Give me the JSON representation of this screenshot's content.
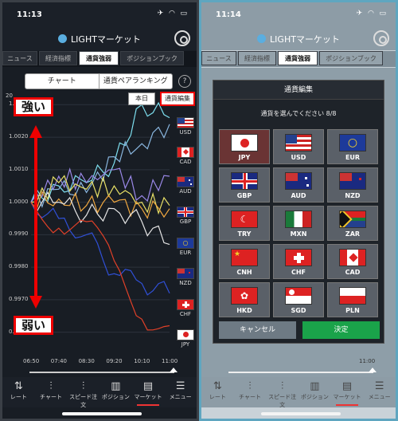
{
  "left": {
    "status_time": "11:13",
    "app_title": "LIGHTマーケット",
    "tabs": [
      "ニュース",
      "経済指標",
      "通貨強弱",
      "ポジションブック"
    ],
    "segment": [
      "チャート",
      "通貨ペアランキング"
    ],
    "help": "?",
    "today_button": "本日",
    "edit_button": "通貨編集",
    "annotation_strong": "強い",
    "annotation_weak": "弱い",
    "y_ticks": [
      "1.0030",
      "1.0020",
      "1.0010",
      "1.0000",
      "0.9990",
      "0.9980",
      "0.9970",
      "0.9960"
    ],
    "y_top_partial": "20",
    "x_ticks": [
      "06:50",
      "07:40",
      "08:30",
      "09:20",
      "10:10",
      "11:00"
    ],
    "legend": [
      "USD",
      "CAD",
      "AUD",
      "GBP",
      "EUR",
      "NZD",
      "CHF",
      "JPY"
    ],
    "chart_data": {
      "type": "line",
      "x": [
        "06:50",
        "07:40",
        "08:30",
        "09:20",
        "10:10",
        "11:00"
      ],
      "ylim": [
        0.9955,
        1.0034
      ],
      "series": [
        {
          "name": "USD",
          "values": [
            1.0,
            1.0005,
            1.0006,
            1.0012,
            1.003,
            1.0026
          ],
          "color": "#7ee0f0"
        },
        {
          "name": "CAD",
          "values": [
            1.0,
            1.0004,
            1.0003,
            1.0014,
            1.0018,
            1.0024
          ],
          "color": "#8ab7e0"
        },
        {
          "name": "AUD",
          "values": [
            1.0,
            1.0008,
            1.0006,
            1.001,
            1.0002,
            1.0008
          ],
          "color": "#9a88e8"
        },
        {
          "name": "GBP",
          "values": [
            1.0,
            1.0006,
            1.0004,
            1.0005,
            1.0,
            0.9999
          ],
          "color": "#e8e066"
        },
        {
          "name": "EUR",
          "values": [
            1.0,
            1.0001,
            0.9999,
            1.0,
            0.9998,
            0.9998
          ],
          "color": "#f0a840"
        },
        {
          "name": "NZD",
          "values": [
            1.0,
            1.0,
            0.9996,
            0.9998,
            0.9994,
            0.9987
          ],
          "color": "#e6e6e6"
        },
        {
          "name": "CHF",
          "values": [
            1.0,
            0.9995,
            0.999,
            0.9978,
            0.9975,
            0.9972
          ],
          "color": "#3050d8"
        },
        {
          "name": "JPY",
          "values": [
            1.0,
            0.9992,
            0.9994,
            0.9982,
            0.9964,
            0.9962
          ],
          "color": "#e04028"
        }
      ]
    },
    "bottom_nav": [
      "レート",
      "チャート",
      "スピード注文",
      "ポジション",
      "マーケット",
      "メニュー"
    ]
  },
  "right": {
    "status_time": "11:14",
    "app_title": "LIGHTマーケット",
    "modal_title": "通貨編集",
    "modal_subtitle": "通貨を選んでください 8/8",
    "currencies": [
      "JPY",
      "USD",
      "EUR",
      "GBP",
      "AUD",
      "NZD",
      "TRY",
      "MXN",
      "ZAR",
      "CNH",
      "CHF",
      "CAD",
      "HKD",
      "SGD",
      "PLN"
    ],
    "cancel_button": "キャンセル",
    "ok_button": "決定",
    "x_tick_last": "11:00"
  },
  "colors": {
    "accent_red": "#e00000",
    "ok_green": "#1aa34a",
    "frame_highlight": "#5fa6c0"
  }
}
